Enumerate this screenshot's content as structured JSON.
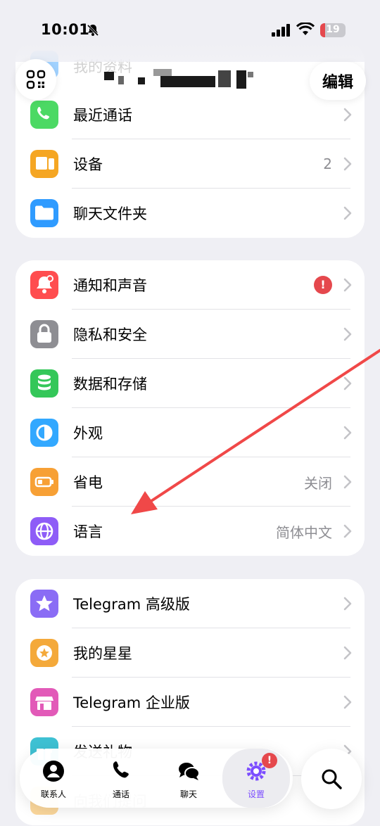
{
  "status_bar": {
    "time": "10:01",
    "battery_level": "19",
    "battery_fraction": 0.19,
    "icons": [
      "bell-slash-icon",
      "signal-icon",
      "wifi-icon",
      "battery-icon"
    ]
  },
  "header": {
    "edit_label": "编辑",
    "qr_icon": "qr-code-icon",
    "profile_hidden_row_label": "我的资料"
  },
  "group1": [
    {
      "label": "最近通话",
      "value": "",
      "icon": "phone-icon",
      "color": "#4cd964"
    },
    {
      "label": "设备",
      "value": "2",
      "icon": "devices-icon",
      "color": "#f5a623"
    },
    {
      "label": "聊天文件夹",
      "value": "",
      "icon": "folder-icon",
      "color": "#2f9bff"
    }
  ],
  "group2": [
    {
      "label": "通知和声音",
      "value": "!",
      "icon": "bell-icon",
      "color": "#ff4d4f"
    },
    {
      "label": "隐私和安全",
      "value": "",
      "icon": "lock-icon",
      "color": "#8e8e93"
    },
    {
      "label": "数据和存储",
      "value": "",
      "icon": "database-icon",
      "color": "#34c759"
    },
    {
      "label": "外观",
      "value": "",
      "icon": "appearance-icon",
      "color": "#32a8ff"
    },
    {
      "label": "省电",
      "value": "关闭",
      "icon": "battery-saver-icon",
      "color": "#f7a035"
    },
    {
      "label": "语言",
      "value": "简体中文",
      "icon": "globe-icon",
      "color": "#8e5cf7"
    }
  ],
  "group3": [
    {
      "label": "Telegram 高级版",
      "value": "",
      "icon": "star-icon",
      "color": "#8a6cf5"
    },
    {
      "label": "我的星星",
      "value": "",
      "icon": "star-coin-icon",
      "color": "#f4a93a"
    },
    {
      "label": "Telegram 企业版",
      "value": "",
      "icon": "store-icon",
      "color": "#e25ab8"
    },
    {
      "label": "发送礼物",
      "value": "",
      "icon": "gift-icon",
      "color": "#3ec1d3"
    }
  ],
  "partial_bottom_label": "向我们提问",
  "tabbar": [
    {
      "label": "联系人",
      "icon": "person-icon",
      "active": false
    },
    {
      "label": "通话",
      "icon": "phone-icon",
      "active": false
    },
    {
      "label": "聊天",
      "icon": "chat-bubbles-icon",
      "active": false
    },
    {
      "label": "设置",
      "icon": "gear-icon",
      "active": true,
      "badge": "!"
    }
  ],
  "search_icon": "search-icon",
  "accent_color": "#7c4dff",
  "annotation_arrow_color": "#f04848"
}
